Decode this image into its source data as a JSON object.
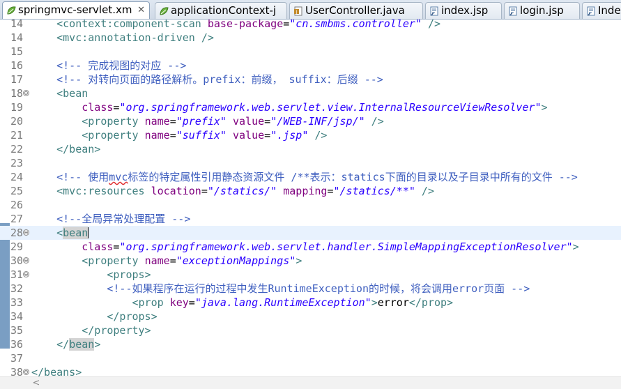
{
  "tabs": [
    {
      "label": "springmvc-servlet.xm",
      "icon": "spring-xml-file-icon",
      "active": true,
      "close": "✕"
    },
    {
      "label": "applicationContext-j",
      "icon": "spring-xml-file-icon",
      "active": false
    },
    {
      "label": "UserController.java",
      "icon": "java-file-icon",
      "active": false
    },
    {
      "label": "index.jsp",
      "icon": "jsp-file-icon",
      "active": false
    },
    {
      "label": "login.jsp",
      "icon": "jsp-file-icon",
      "active": false
    },
    {
      "label": "Inde",
      "icon": "jsp-file-icon",
      "active": false
    }
  ],
  "editor": {
    "current_line": 28,
    "lines": [
      {
        "n": "14",
        "fold": "",
        "segs": [
          [
            "t",
            "    <context:component-scan "
          ],
          [
            "a",
            "base-package"
          ],
          [
            "x",
            "="
          ],
          [
            "v",
            "\"cn.smbms.controller\""
          ],
          [
            "t",
            " />"
          ]
        ]
      },
      {
        "n": "14",
        "fold": "",
        "segs": [
          [
            "t",
            "    <mvc:annotation-driven />"
          ]
        ]
      },
      {
        "n": "15",
        "fold": "",
        "segs": []
      },
      {
        "n": "16",
        "fold": "",
        "segs": [
          [
            "c",
            "    <!-- 完成视图的对应 -->"
          ]
        ]
      },
      {
        "n": "17",
        "fold": "",
        "segs": [
          [
            "c",
            "    <!-- 对转向页面的路径解析。prefix：前缀， suffix：后缀 -->"
          ]
        ]
      },
      {
        "n": "18",
        "fold": "⊖",
        "segs": [
          [
            "t",
            "    <bean"
          ]
        ]
      },
      {
        "n": "19",
        "fold": "",
        "segs": [
          [
            "x",
            "        "
          ],
          [
            "a",
            "class"
          ],
          [
            "x",
            "="
          ],
          [
            "v",
            "\"org.springframework.web.servlet.view.InternalResourceViewResolver\""
          ],
          [
            "t",
            ">"
          ]
        ]
      },
      {
        "n": "20",
        "fold": "",
        "segs": [
          [
            "t",
            "        <property "
          ],
          [
            "a",
            "name"
          ],
          [
            "x",
            "="
          ],
          [
            "v",
            "\"prefix\""
          ],
          [
            "x",
            " "
          ],
          [
            "a",
            "value"
          ],
          [
            "x",
            "="
          ],
          [
            "v",
            "\"/WEB-INF/jsp/\""
          ],
          [
            "t",
            " />"
          ]
        ]
      },
      {
        "n": "21",
        "fold": "",
        "segs": [
          [
            "t",
            "        <property "
          ],
          [
            "a",
            "name"
          ],
          [
            "x",
            "="
          ],
          [
            "v",
            "\"suffix\""
          ],
          [
            "x",
            " "
          ],
          [
            "a",
            "value"
          ],
          [
            "x",
            "="
          ],
          [
            "v",
            "\".jsp\""
          ],
          [
            "t",
            " />"
          ]
        ]
      },
      {
        "n": "22",
        "fold": "",
        "segs": [
          [
            "t",
            "    </bean>"
          ]
        ]
      },
      {
        "n": "23",
        "fold": "",
        "segs": []
      },
      {
        "n": "24",
        "fold": "",
        "segs": [
          [
            "c",
            "    <!-- 使用"
          ],
          [
            "csq",
            "mvc"
          ],
          [
            "c",
            "标签的特定属性引用静态资源文件 /**表示：statics下面的目录以及子目录中所有的文件 -->"
          ]
        ]
      },
      {
        "n": "25",
        "fold": "",
        "segs": [
          [
            "t",
            "    <mvc:resources "
          ],
          [
            "a",
            "location"
          ],
          [
            "x",
            "="
          ],
          [
            "v",
            "\"/statics/\""
          ],
          [
            "x",
            " "
          ],
          [
            "a",
            "mapping"
          ],
          [
            "x",
            "="
          ],
          [
            "v",
            "\"/statics/**\""
          ],
          [
            "t",
            " />"
          ]
        ]
      },
      {
        "n": "26",
        "fold": "",
        "segs": []
      },
      {
        "n": "27",
        "fold": "",
        "segs": [
          [
            "c",
            "    <!--全局异常处理配置 -->"
          ]
        ]
      },
      {
        "n": "28",
        "fold": "⊖",
        "segs": [
          [
            "t",
            "    <"
          ],
          [
            "thl",
            "bean"
          ],
          [
            "caret",
            ""
          ]
        ]
      },
      {
        "n": "29",
        "fold": "",
        "segs": [
          [
            "x",
            "        "
          ],
          [
            "a",
            "class"
          ],
          [
            "x",
            "="
          ],
          [
            "v",
            "\"org.springframework.web.servlet.handler.SimpleMappingExceptionResolver\""
          ],
          [
            "t",
            ">"
          ]
        ]
      },
      {
        "n": "30",
        "fold": "⊖",
        "segs": [
          [
            "t",
            "        <property "
          ],
          [
            "a",
            "name"
          ],
          [
            "x",
            "="
          ],
          [
            "v",
            "\"exceptionMappings\""
          ],
          [
            "t",
            ">"
          ]
        ]
      },
      {
        "n": "31",
        "fold": "⊖",
        "segs": [
          [
            "t",
            "            <props>"
          ]
        ]
      },
      {
        "n": "32",
        "fold": "",
        "segs": [
          [
            "c",
            "            <!--如果程序在运行的过程中发生RuntimeException的时候，将会调用error页面 -->"
          ]
        ]
      },
      {
        "n": "33",
        "fold": "",
        "segs": [
          [
            "t",
            "                <prop "
          ],
          [
            "a",
            "key"
          ],
          [
            "x",
            "="
          ],
          [
            "v",
            "\"java.lang.RuntimeException\""
          ],
          [
            "t",
            ">"
          ],
          [
            "x",
            "error"
          ],
          [
            "t",
            "</prop>"
          ]
        ]
      },
      {
        "n": "34",
        "fold": "",
        "segs": [
          [
            "t",
            "            </props>"
          ]
        ]
      },
      {
        "n": "35",
        "fold": "",
        "segs": [
          [
            "t",
            "        </property>"
          ]
        ]
      },
      {
        "n": "36",
        "fold": "",
        "segs": [
          [
            "t",
            "    </"
          ],
          [
            "thl",
            "bean"
          ],
          [
            "t",
            ">"
          ]
        ]
      },
      {
        "n": "37",
        "fold": "",
        "segs": []
      },
      {
        "n": "38",
        "fold": "⊖",
        "segs": [
          [
            "t",
            "</beans>"
          ]
        ]
      }
    ]
  },
  "scrollbar": {
    "left_arrow": "<"
  },
  "colors": {
    "tag": "#3f7f7f",
    "attribute": "#7f007f",
    "value": "#2a00ff",
    "comment": "#3f5fbf",
    "current_line": "#e8f2fe",
    "change_bar": "#7a9ec3"
  }
}
